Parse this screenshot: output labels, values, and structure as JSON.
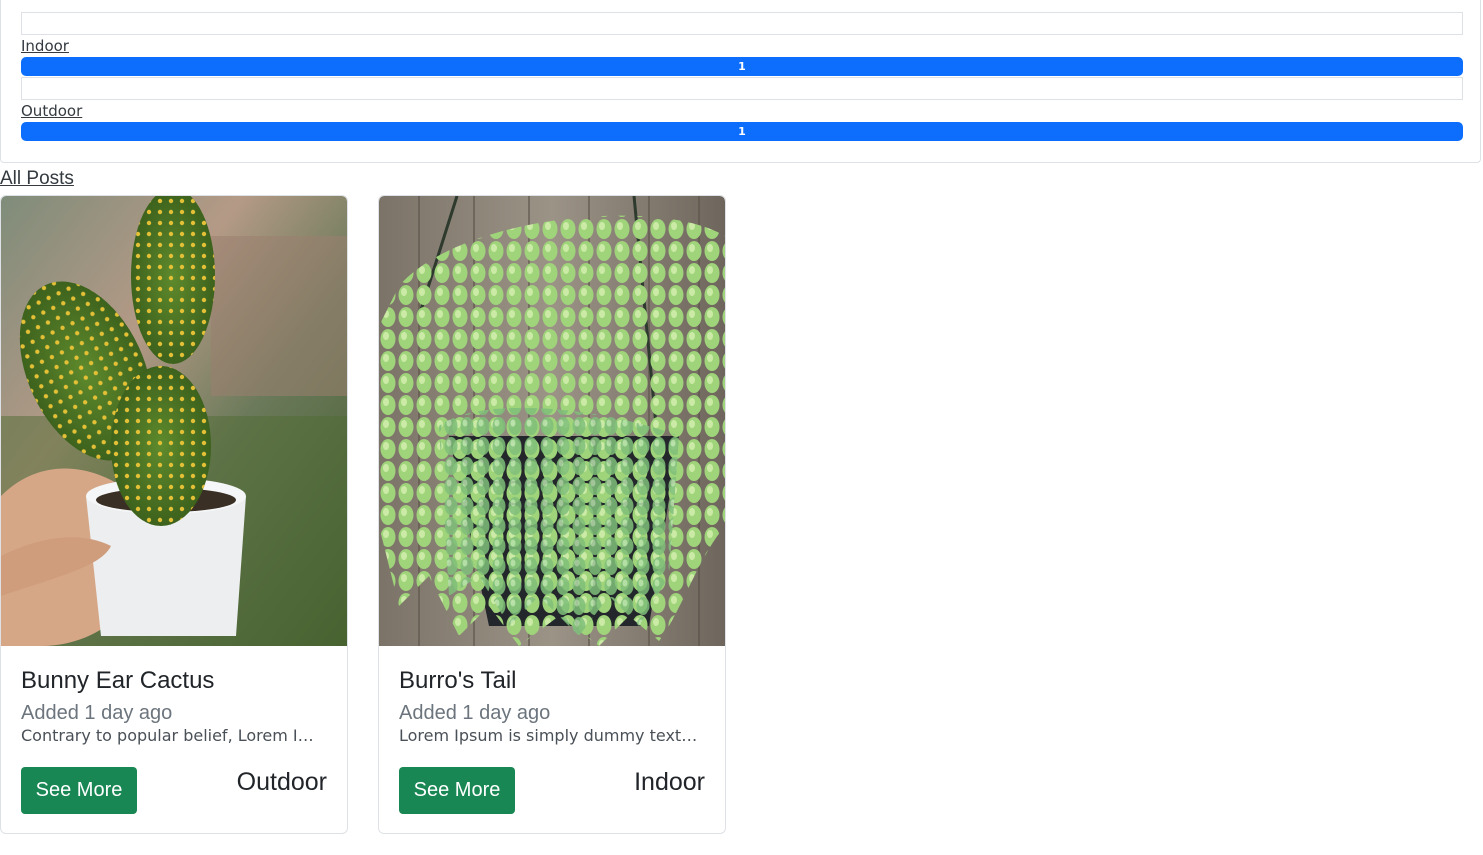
{
  "categories": [
    {
      "name": "Indoor",
      "count_label": "1",
      "progress": 1.0
    },
    {
      "name": "Outdoor",
      "count_label": "1",
      "progress": 1.0
    }
  ],
  "all_posts_label": "All Posts",
  "posts": [
    {
      "title": "Bunny Ear Cactus",
      "added": "Added 1 day ago",
      "excerpt": "Contrary to popular belief, Lorem Ipsum is not simply random text.",
      "button_label": "See More",
      "category": "Outdoor"
    },
    {
      "title": "Burro's Tail",
      "added": "Added 1 day ago",
      "excerpt": "Lorem Ipsum is simply dummy text of the printing and typesetting industry.",
      "button_label": "See More",
      "category": "Indoor"
    }
  ],
  "colors": {
    "progress_bar": "#0d6efd",
    "button": "#198754",
    "muted_text": "#6c757d"
  }
}
